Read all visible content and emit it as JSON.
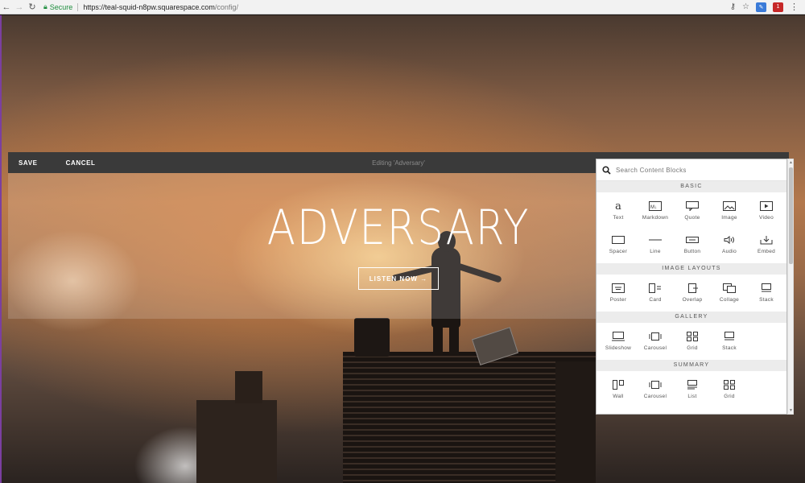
{
  "browser": {
    "secure_label": "Secure",
    "url_host": "https://teal-squid-n8pw.squarespace.com",
    "url_path": "/config/",
    "ext_red_badge": "1"
  },
  "editor": {
    "save_label": "SAVE",
    "cancel_label": "CANCEL",
    "editing_title": "Editing 'Adversary'"
  },
  "hero": {
    "title": "ADVERSARY",
    "button_label": "LISTEN NOW →"
  },
  "panel": {
    "search_placeholder": "Search Content Blocks",
    "sections": [
      {
        "title": "BASIC",
        "items": [
          {
            "label": "Text",
            "icon": "text-icon"
          },
          {
            "label": "Markdown",
            "icon": "markdown-icon"
          },
          {
            "label": "Quote",
            "icon": "quote-icon"
          },
          {
            "label": "Image",
            "icon": "image-icon"
          },
          {
            "label": "Video",
            "icon": "video-icon"
          },
          {
            "label": "Spacer",
            "icon": "spacer-icon"
          },
          {
            "label": "Line",
            "icon": "line-icon"
          },
          {
            "label": "Button",
            "icon": "button-icon"
          },
          {
            "label": "Audio",
            "icon": "audio-icon"
          },
          {
            "label": "Embed",
            "icon": "embed-icon"
          }
        ]
      },
      {
        "title": "IMAGE LAYOUTS",
        "items": [
          {
            "label": "Poster",
            "icon": "poster-icon"
          },
          {
            "label": "Card",
            "icon": "card-icon"
          },
          {
            "label": "Overlap",
            "icon": "overlap-icon"
          },
          {
            "label": "Collage",
            "icon": "collage-icon"
          },
          {
            "label": "Stack",
            "icon": "stack-icon"
          }
        ]
      },
      {
        "title": "GALLERY",
        "items": [
          {
            "label": "Slideshow",
            "icon": "slideshow-icon"
          },
          {
            "label": "Carousel",
            "icon": "carousel-icon"
          },
          {
            "label": "Grid",
            "icon": "grid-icon"
          },
          {
            "label": "Stack",
            "icon": "stack-icon"
          }
        ]
      },
      {
        "title": "SUMMARY",
        "items": [
          {
            "label": "Wall",
            "icon": "wall-icon"
          },
          {
            "label": "Carousel",
            "icon": "carousel-icon"
          },
          {
            "label": "List",
            "icon": "list-icon"
          },
          {
            "label": "Grid",
            "icon": "grid-icon"
          }
        ]
      }
    ]
  }
}
